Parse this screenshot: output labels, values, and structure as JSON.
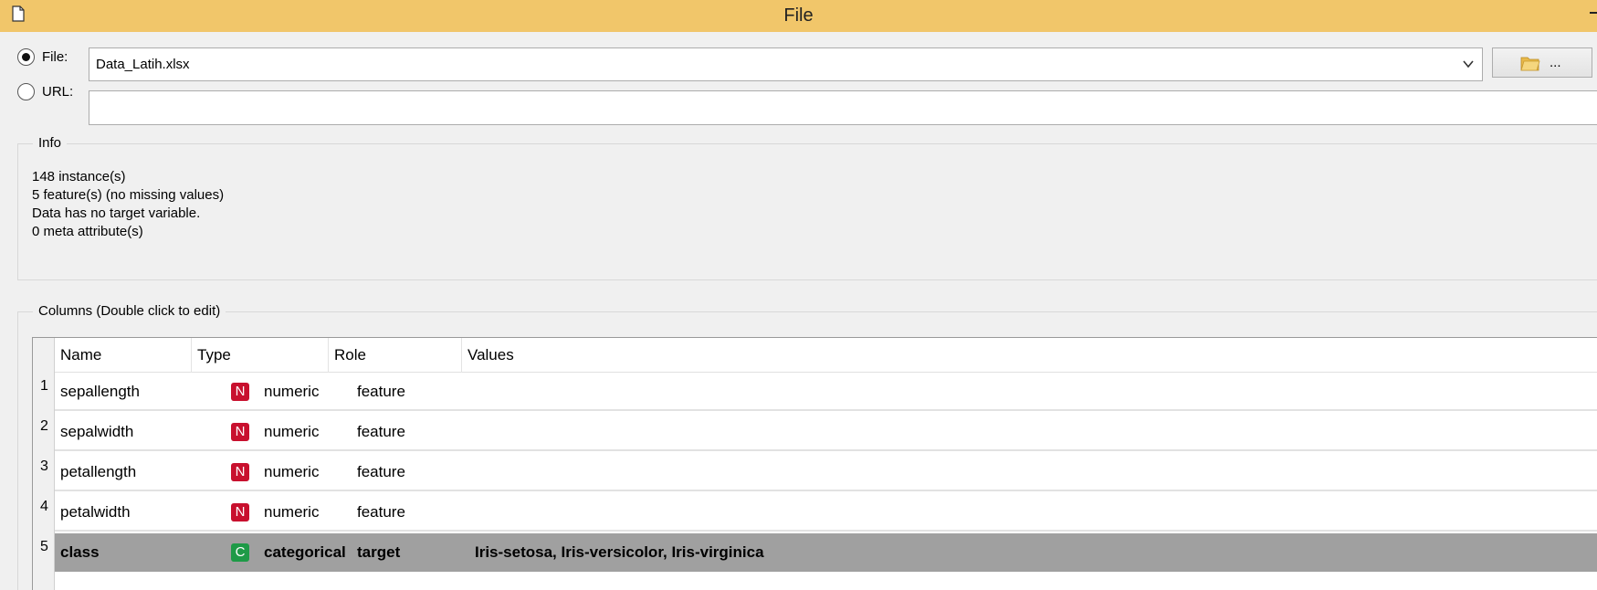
{
  "window": {
    "title": "File"
  },
  "source": {
    "file_label": "File:",
    "url_label": "URL:",
    "file_value": "Data_Latih.xlsx",
    "url_value": "",
    "browse_label": "..."
  },
  "info": {
    "title": "Info",
    "lines": [
      "148 instance(s)",
      "5 feature(s) (no missing values)",
      "Data has no target variable.",
      "0 meta attribute(s)"
    ]
  },
  "columns": {
    "title": "Columns (Double click to edit)",
    "headers": [
      "Name",
      "Type",
      "Role",
      "Values"
    ],
    "rows": [
      {
        "num": "1",
        "name": "sepallength",
        "type_badge": "N",
        "type": "numeric",
        "role": "feature",
        "values": ""
      },
      {
        "num": "2",
        "name": "sepalwidth",
        "type_badge": "N",
        "type": "numeric",
        "role": "feature",
        "values": ""
      },
      {
        "num": "3",
        "name": "petallength",
        "type_badge": "N",
        "type": "numeric",
        "role": "feature",
        "values": ""
      },
      {
        "num": "4",
        "name": "petalwidth",
        "type_badge": "N",
        "type": "numeric",
        "role": "feature",
        "values": ""
      },
      {
        "num": "5",
        "name": "class",
        "type_badge": "C",
        "type": "categorical",
        "role": "target",
        "values": "Iris-setosa, Iris-versicolor, Iris-virginica"
      }
    ]
  },
  "colors": {
    "titlebar": "#f1c66a",
    "numeric_badge": "#c8102e",
    "categorical_badge": "#1e9a47",
    "selected_row": "#a0a0a0"
  }
}
